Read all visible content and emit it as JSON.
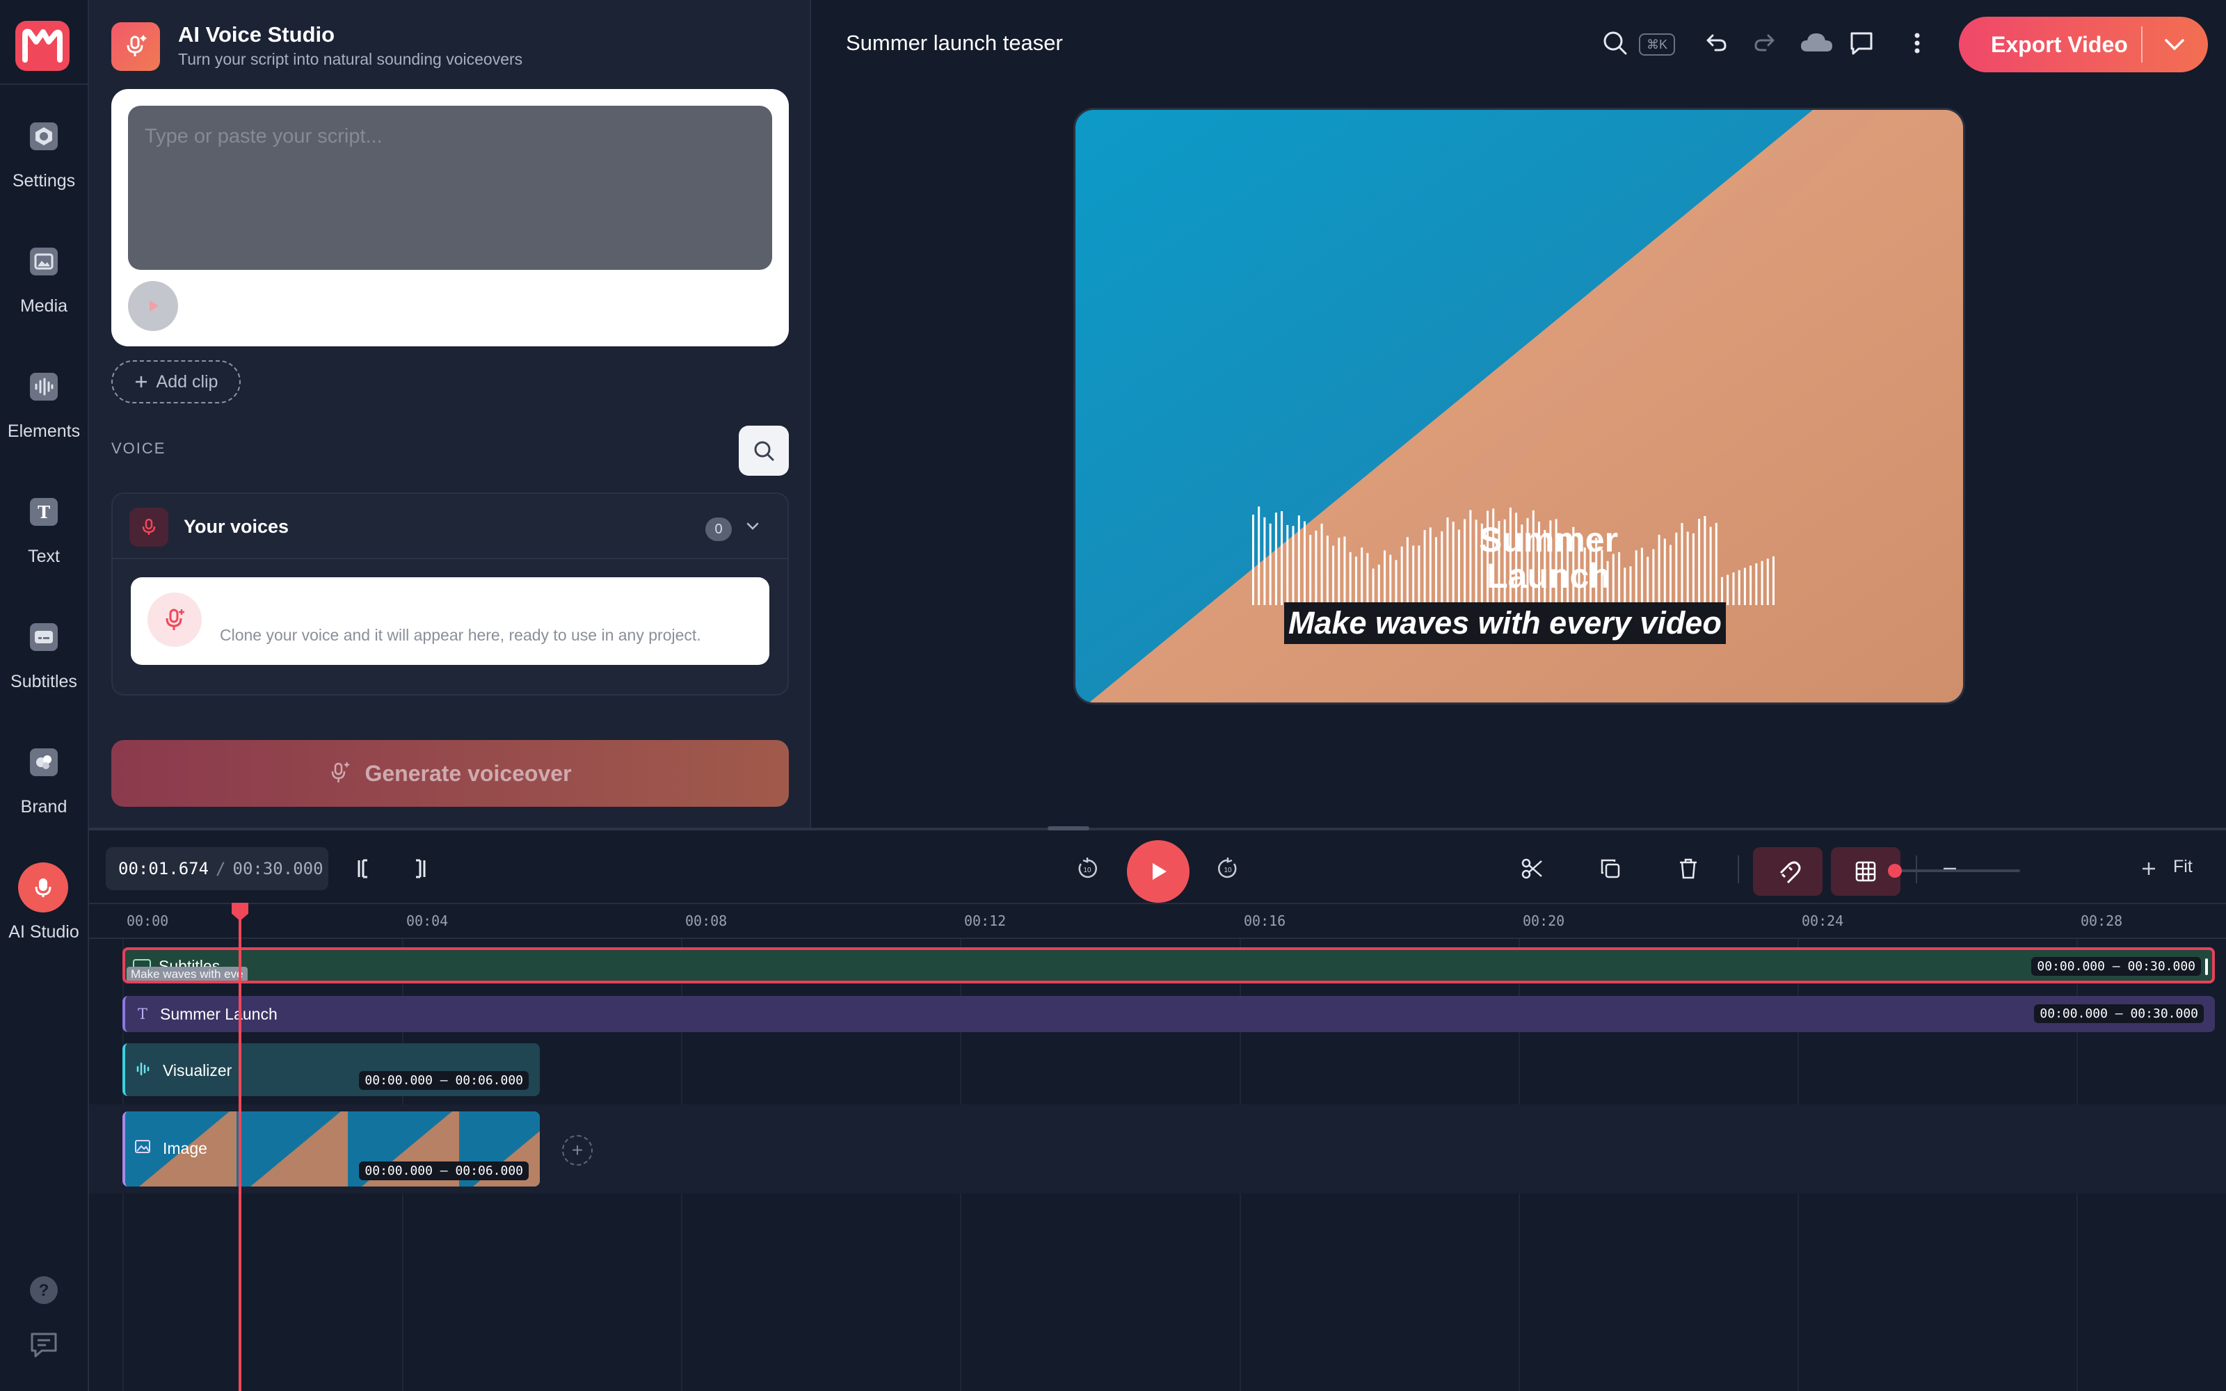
{
  "app": {
    "rail": [
      {
        "label": "Settings",
        "icon": "settings-icon"
      },
      {
        "label": "Media",
        "icon": "media-icon"
      },
      {
        "label": "Elements",
        "icon": "elements-icon"
      },
      {
        "label": "Text",
        "icon": "text-icon"
      },
      {
        "label": "Subtitles",
        "icon": "subtitles-icon"
      },
      {
        "label": "Brand",
        "icon": "brand-icon"
      },
      {
        "label": "AI Studio",
        "icon": "ai-studio-icon"
      }
    ]
  },
  "panel": {
    "title": "AI Voice Studio",
    "subtitle": "Turn your script into natural sounding voiceovers",
    "script_placeholder": "Type or paste your script...",
    "add_clip": "Add clip",
    "voice_section": "VOICE",
    "your_voices": "Your voices",
    "voices_count": "0",
    "clone_hint": "Clone your voice and it will appear here, ready to use in any project.",
    "generate": "Generate voiceover"
  },
  "topbar": {
    "doc_title": "Summer launch teaser",
    "shortcut": "⌘K",
    "export": "Export Video"
  },
  "preview": {
    "title": "Summer Launch",
    "subtitle": "Make waves with every video"
  },
  "timeline": {
    "current_time": "00:01.674",
    "separator": "/",
    "duration": "00:30.000",
    "zoom_fit": "Fit",
    "ticks": [
      "00:00",
      "00:04",
      "00:08",
      "00:12",
      "00:16",
      "00:20",
      "00:24",
      "00:28"
    ],
    "tracks": {
      "subtitles": {
        "name": "Subtitles",
        "snippet": "Make waves with eve",
        "range": "00:00.000 – 00:30.000"
      },
      "text": {
        "name": "Summer Launch",
        "range": "00:00.000 – 00:30.000"
      },
      "visualizer": {
        "name": "Visualizer",
        "range": "00:00.000 – 00:06.000"
      },
      "image": {
        "name": "Image",
        "range": "00:00.000 – 00:06.000"
      }
    }
  },
  "colors": {
    "accent": "#f0475a",
    "export_gradient_start": "#f0486a",
    "export_gradient_end": "#f26f52",
    "background": "#141b2b",
    "panel": "#1c2334"
  }
}
